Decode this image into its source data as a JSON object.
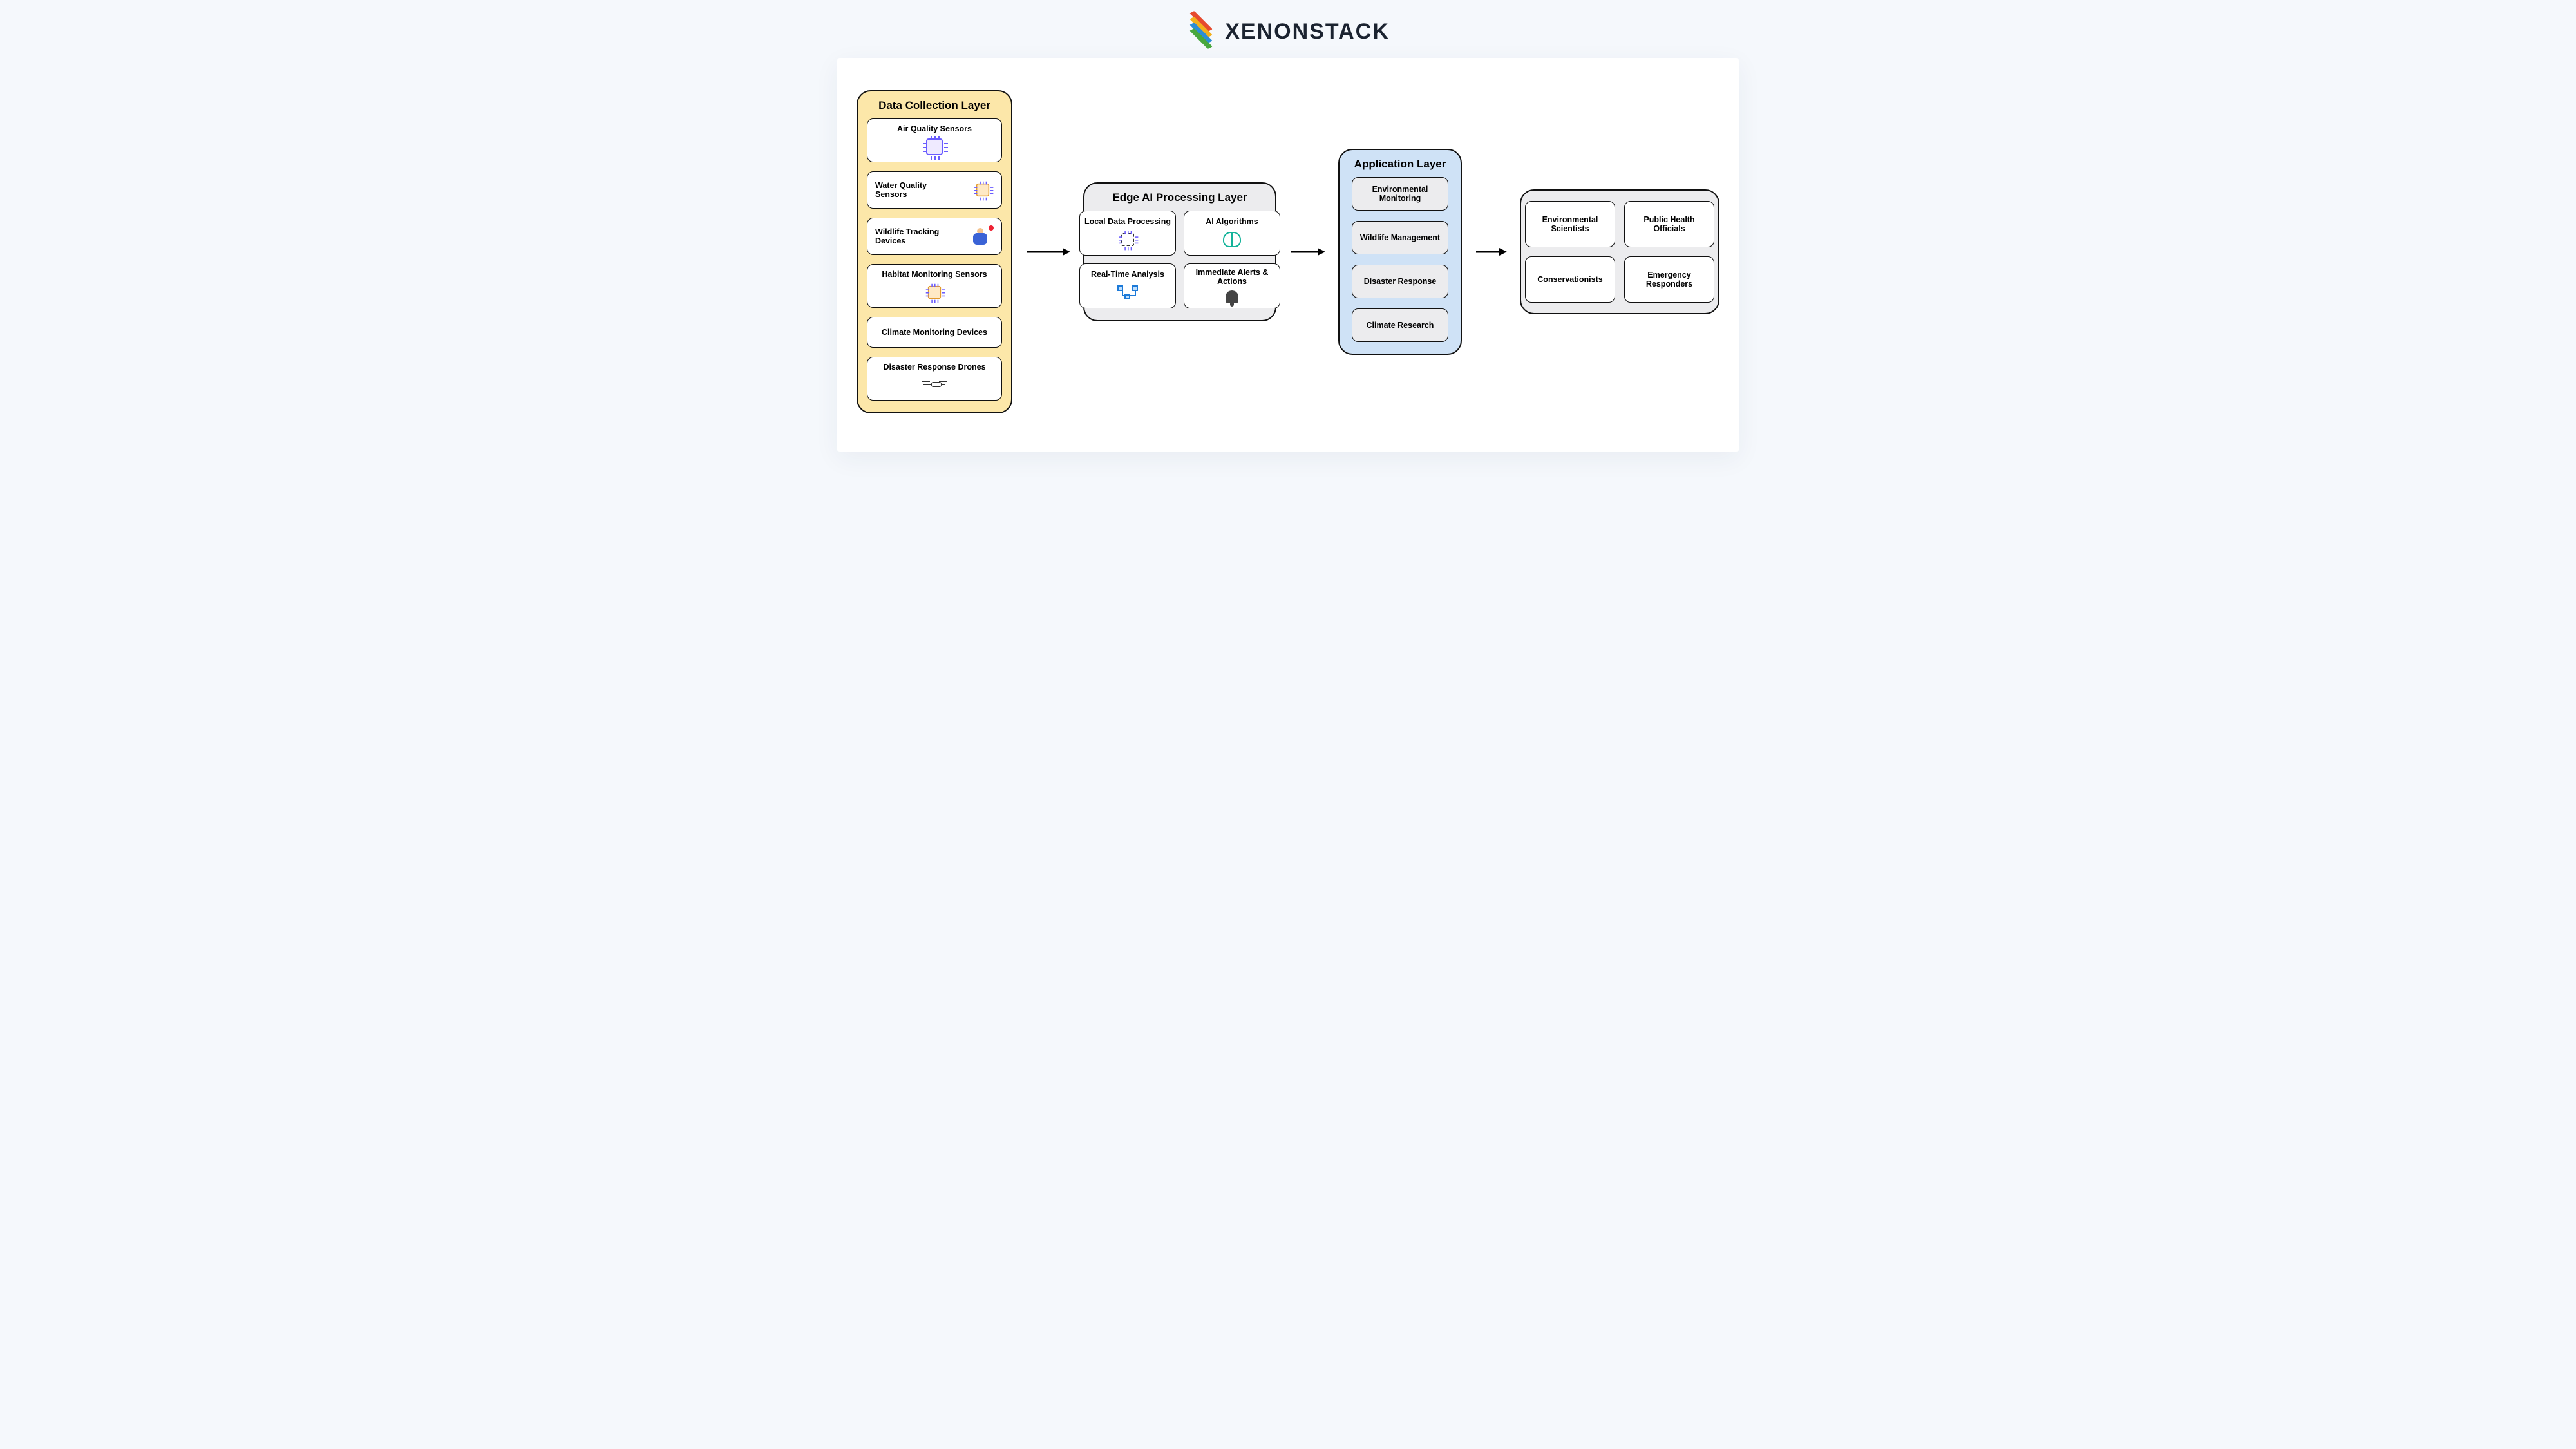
{
  "brand": {
    "name": "XENONSTACK"
  },
  "layers": {
    "data_collection": {
      "title": "Data Collection Layer",
      "items": [
        "Air Quality Sensors",
        "Water Quality Sensors",
        "Wildlife Tracking Devices",
        "Habitat Monitoring Sensors",
        "Climate Monitoring Devices",
        "Disaster Response Drones"
      ]
    },
    "edge_processing": {
      "title": "Edge AI Processing Layer",
      "items": [
        "Local Data Processing",
        "AI Algorithms",
        "Real-Time Analysis",
        "Immediate Alerts & Actions"
      ]
    },
    "application": {
      "title": "Application Layer",
      "items": [
        "Environmental Monitoring",
        "Wildlife Management",
        "Disaster Response",
        "Climate Research"
      ]
    },
    "users": {
      "items": [
        "Environmental Scientists",
        "Public Health Officials",
        "Conservationists",
        "Emergency Responders"
      ]
    }
  }
}
